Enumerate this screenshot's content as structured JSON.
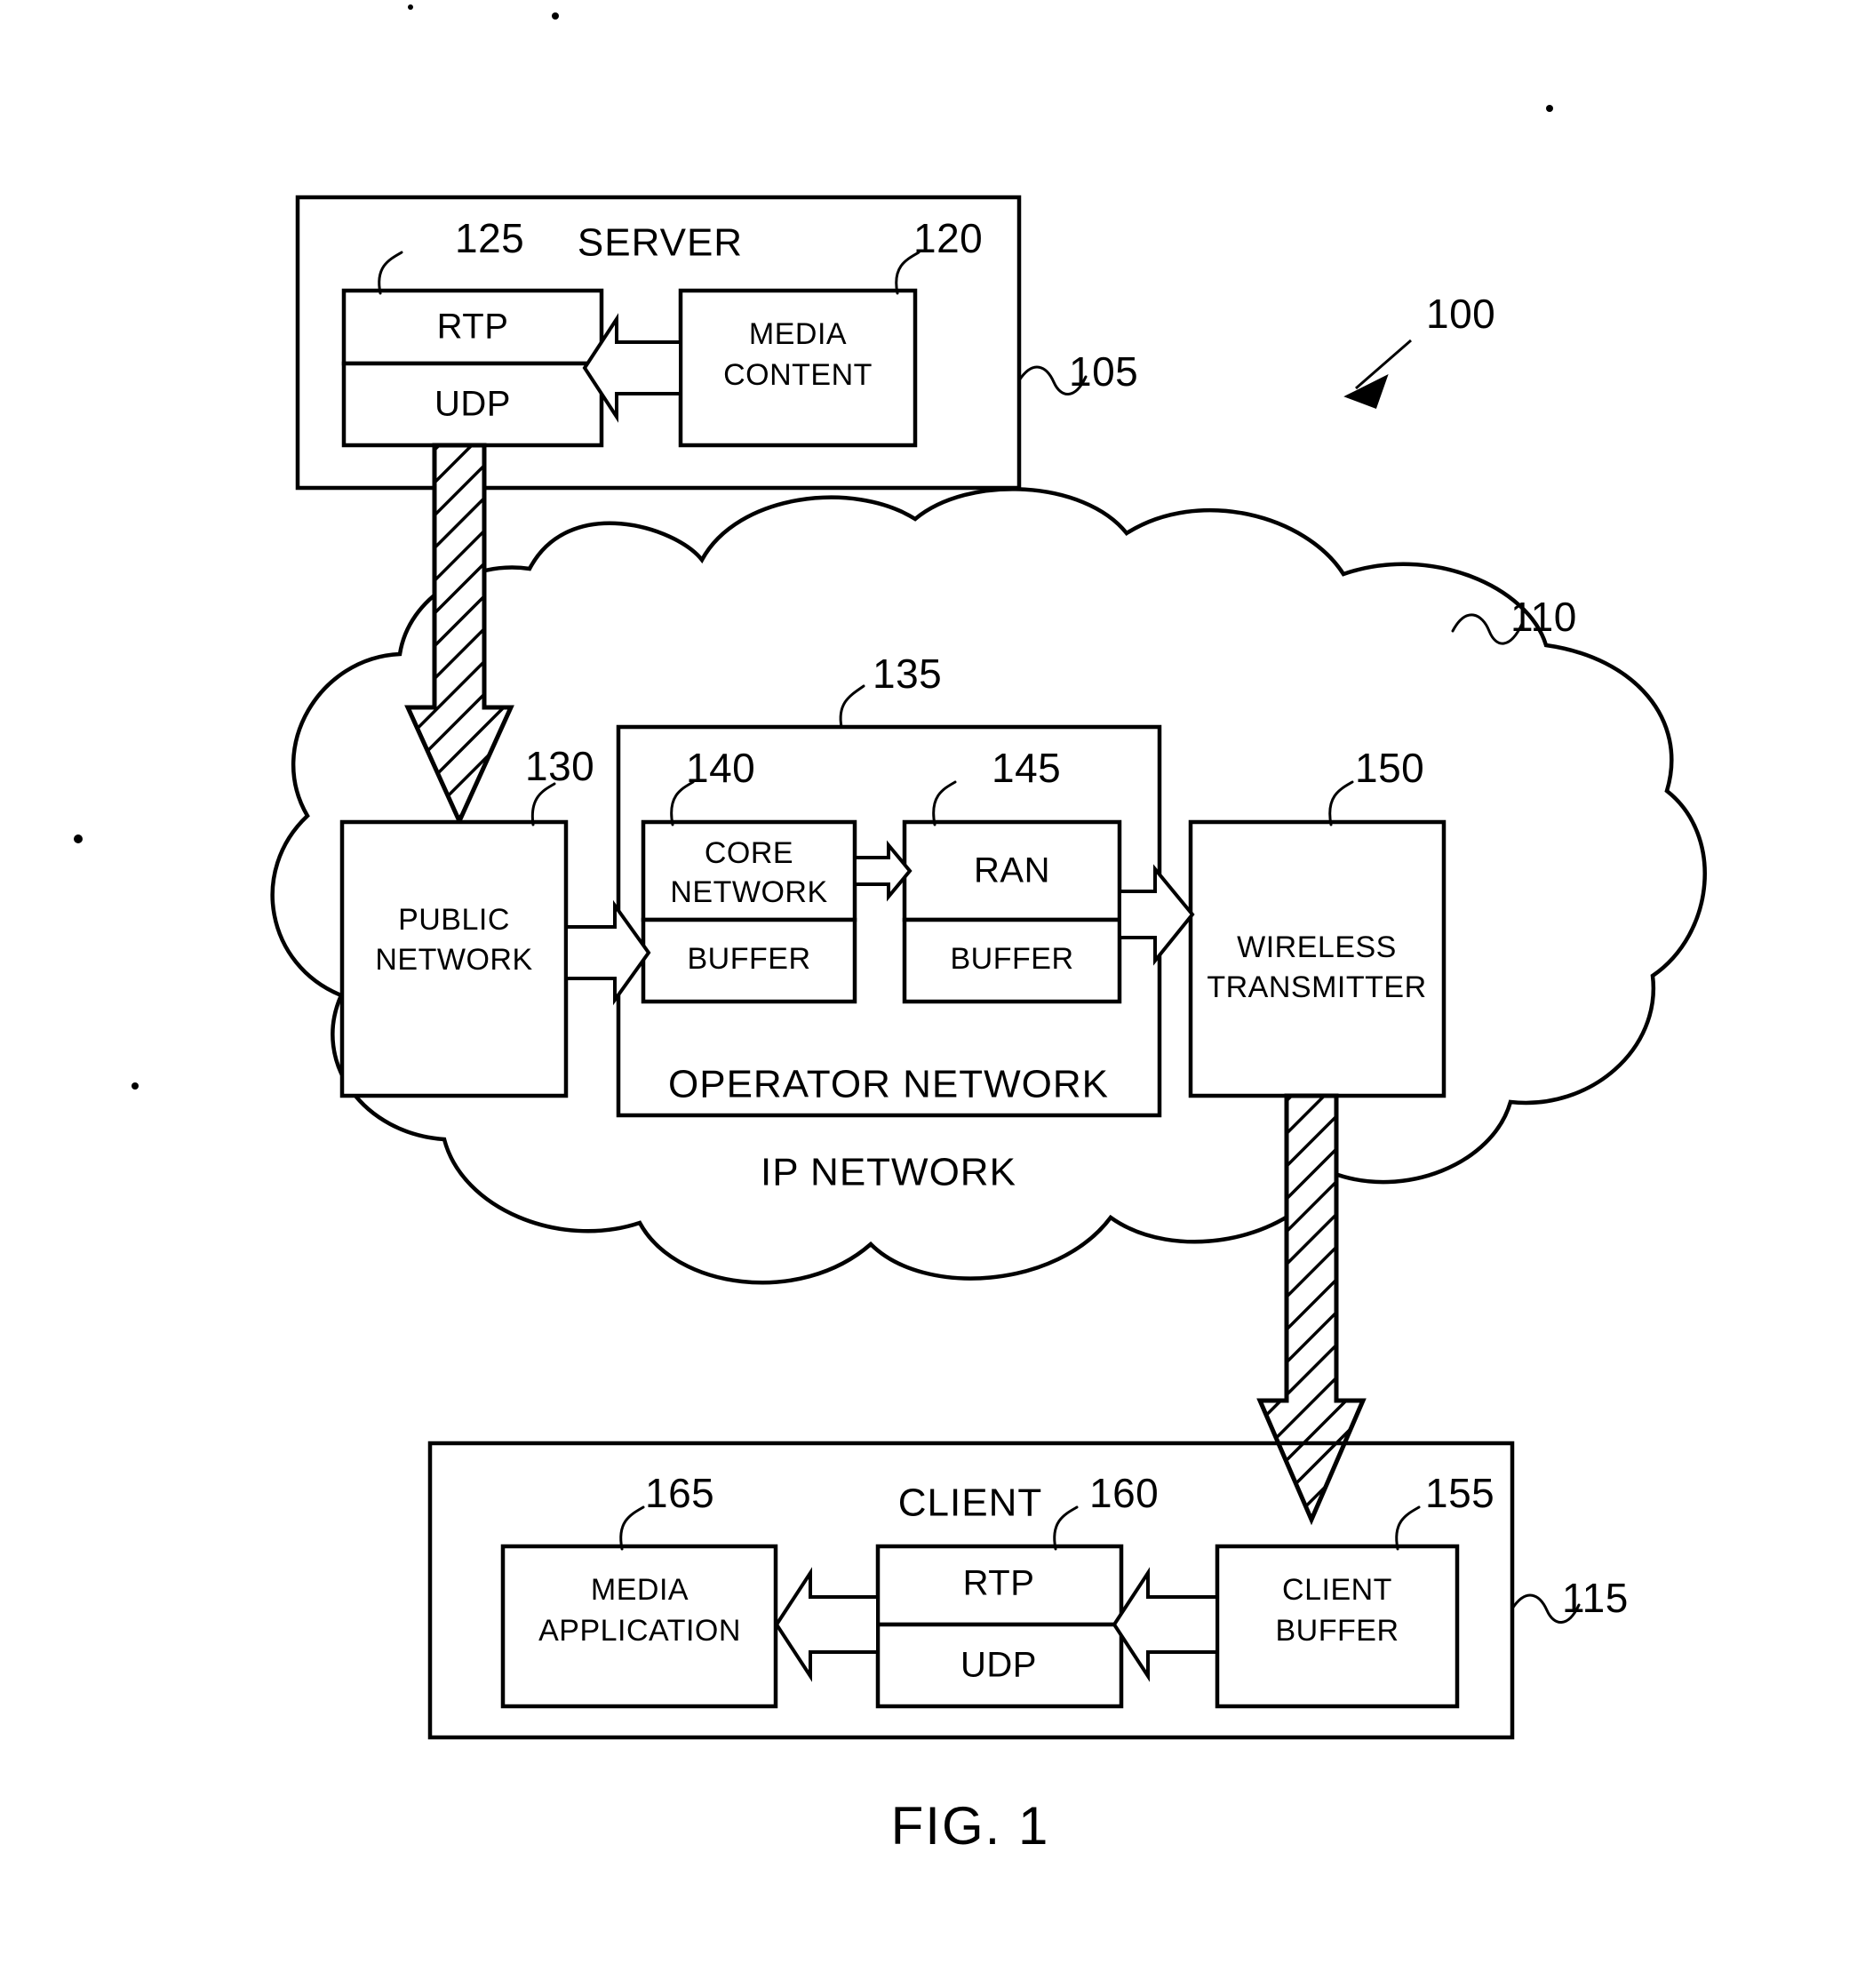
{
  "figure": {
    "caption": "FIG. 1",
    "system_ref": "100"
  },
  "server": {
    "title": "SERVER",
    "ref": "105",
    "stack": {
      "ref": "125",
      "upper_label": "RTP",
      "lower_label": "UDP"
    },
    "media_content": {
      "ref": "120",
      "label_line1": "MEDIA",
      "label_line2": "CONTENT"
    }
  },
  "ip_network": {
    "label": "IP NETWORK",
    "ref": "110",
    "public_network": {
      "ref": "130",
      "label_line1": "PUBLIC",
      "label_line2": "NETWORK"
    },
    "operator_network": {
      "ref": "135",
      "label": "OPERATOR NETWORK",
      "core_network": {
        "ref": "140",
        "label_line1": "CORE",
        "label_line2": "NETWORK",
        "buffer_label": "BUFFER"
      },
      "ran": {
        "ref": "145",
        "label": "RAN",
        "buffer_label": "BUFFER"
      }
    },
    "wireless_transmitter": {
      "ref": "150",
      "label_line1": "WIRELESS",
      "label_line2": "TRANSMITTER"
    }
  },
  "client": {
    "title": "CLIENT",
    "ref": "115",
    "media_application": {
      "ref": "165",
      "label_line1": "MEDIA",
      "label_line2": "APPLICATION"
    },
    "stack": {
      "ref": "160",
      "upper_label": "RTP",
      "lower_label": "UDP"
    },
    "client_buffer": {
      "ref": "155",
      "label_line1": "CLIENT",
      "label_line2": "BUFFER"
    }
  },
  "colors": {
    "ink": "#000000",
    "paper": "#ffffff"
  }
}
